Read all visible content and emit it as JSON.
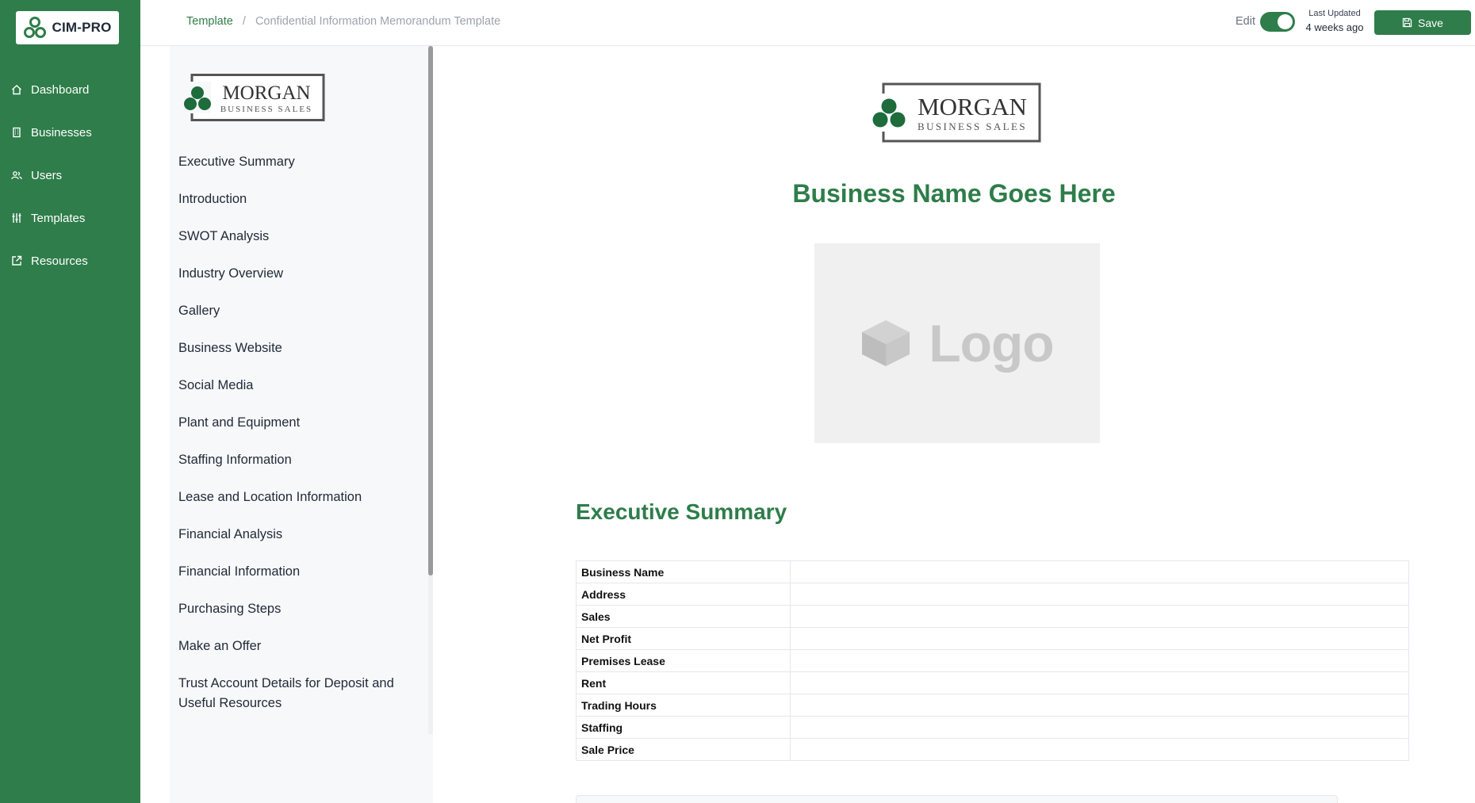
{
  "brand": {
    "name": "CIM-PRO"
  },
  "nav": [
    {
      "label": "Dashboard",
      "icon": "home-icon"
    },
    {
      "label": "Businesses",
      "icon": "building-icon"
    },
    {
      "label": "Users",
      "icon": "users-icon"
    },
    {
      "label": "Templates",
      "icon": "sliders-icon"
    },
    {
      "label": "Resources",
      "icon": "external-link-icon"
    }
  ],
  "breadcrumb": {
    "parent": "Template",
    "separator": "/",
    "current": "Confidential Information Memorandum Template"
  },
  "header": {
    "edit_label": "Edit",
    "edit_enabled": true,
    "last_updated_label": "Last Updated",
    "last_updated_value": "4 weeks ago",
    "save_label": "Save"
  },
  "logo": {
    "name": "MORGAN",
    "tagline": "BUSINESS SALES"
  },
  "outline": [
    "Executive Summary",
    "Introduction",
    "SWOT Analysis",
    "Industry Overview",
    "Gallery",
    "Business Website",
    "Social Media",
    "Plant and Equipment",
    "Staffing Information",
    "Lease and Location Information",
    "Financial Analysis",
    "Financial Information",
    "Purchasing Steps",
    "Make an Offer",
    "Trust Account Details for Deposit and Useful Resources"
  ],
  "document": {
    "business_title": "Business Name Goes Here",
    "placeholder_text": "Logo",
    "section_title": "Executive Summary",
    "summary_rows": [
      {
        "label": "Business Name",
        "value": ""
      },
      {
        "label": "Address",
        "value": ""
      },
      {
        "label": "Sales",
        "value": ""
      },
      {
        "label": "Net Profit",
        "value": ""
      },
      {
        "label": "Premises Lease",
        "value": ""
      },
      {
        "label": "Rent",
        "value": ""
      },
      {
        "label": "Trading Hours",
        "value": ""
      },
      {
        "label": "Staffing",
        "value": ""
      },
      {
        "label": "Sale Price",
        "value": ""
      }
    ]
  },
  "colors": {
    "primary": "#2e7d4a",
    "outline_bg": "#f7f8fa",
    "placeholder_bg": "#f0f0f0"
  }
}
